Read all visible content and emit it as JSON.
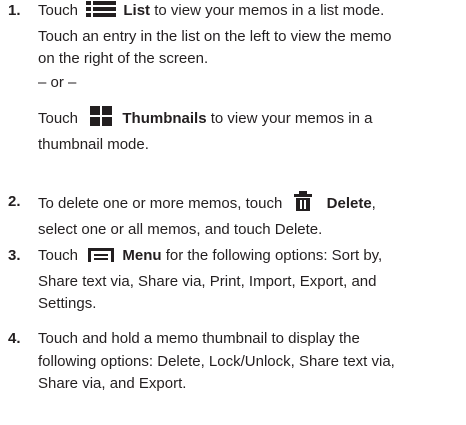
{
  "steps": [
    {
      "num": "1.",
      "line1_pre": "Touch",
      "list_label": "List",
      "line1_post": "to view your memos in a list mode.",
      "line2": "Touch an entry in the list on the left to view the memo",
      "line3": "on the right of the screen.",
      "or_text": "– or –",
      "line4_pre": "Touch",
      "thumbnails_label": "Thumbnails",
      "line4_post": "to view your memos in a",
      "line5": "thumbnail mode.",
      "icons": [
        "list-icon",
        "thumbnails-icon"
      ]
    },
    {
      "num": "2.",
      "line1_pre": "To delete one or more memos, touch",
      "delete_label": "Delete",
      "line2": "select one or all memos, and touch Delete.",
      "icons": [
        "trash-icon"
      ]
    },
    {
      "num": "3.",
      "line1_pre": "Touch",
      "menu_label": "Menu",
      "line1_post": "for the following options: Sort by,",
      "line2": "Share text via, Share via, Print, Import, Export, and",
      "line3": "Settings.",
      "icons": [
        "menu-icon"
      ]
    },
    {
      "num": "4.",
      "line1": "Touch and hold a memo thumbnail to display the",
      "line2": "following options: Delete, Lock/Unlock, Share text via,",
      "line3": "Share via, and Export."
    }
  ],
  "colors": {
    "text": "#231f20",
    "icon": "#231f20"
  }
}
